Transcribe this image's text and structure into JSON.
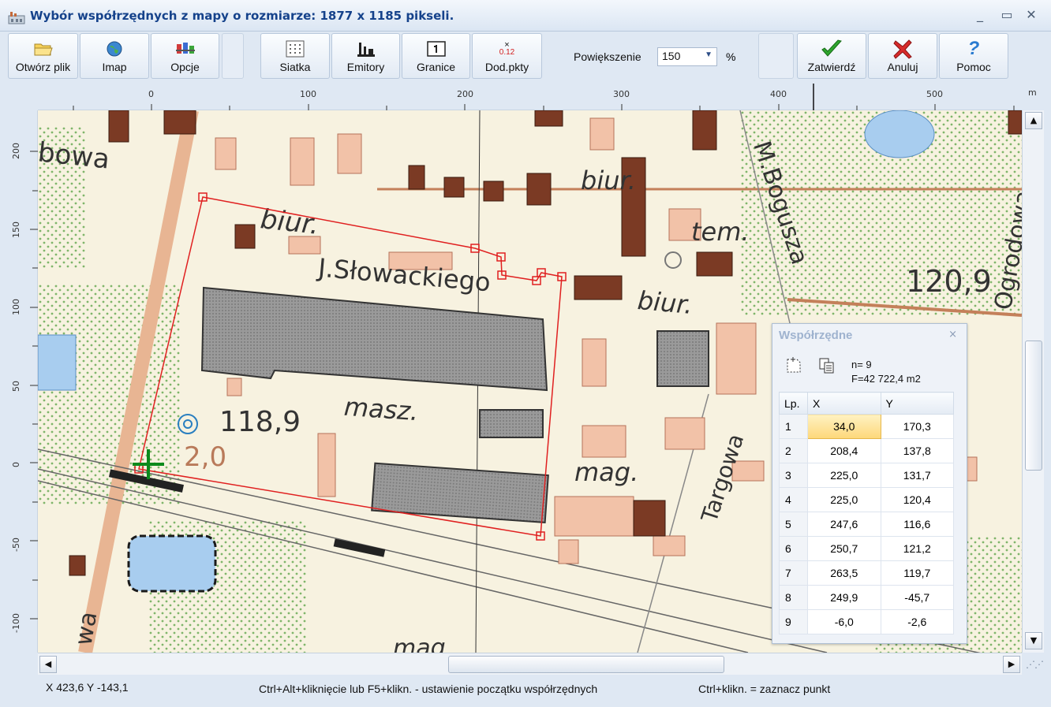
{
  "window": {
    "title": "Wybór współrzędnych z mapy o rozmiarze: 1877 x 1185 pikseli.",
    "minimize": "_",
    "maximize": "▭",
    "close": "✕"
  },
  "toolbar": {
    "open_file": "Otwórz plik",
    "imap": "Imap",
    "options": "Opcje",
    "grid": "Siatka",
    "emitters": "Emitory",
    "boundaries": "Granice",
    "add_points": "Dod.pkty",
    "add_points_icon_text": "0.12",
    "zoom_label": "Powiększenie",
    "zoom_value": "150",
    "zoom_unit": "%",
    "confirm": "Zatwierdź",
    "cancel": "Anuluj",
    "help": "Pomoc"
  },
  "ruler": {
    "x_ticks": [
      "0",
      "100",
      "200",
      "300",
      "400",
      "500"
    ],
    "x_unit": "m",
    "y_ticks": [
      "200",
      "150",
      "100",
      "50",
      "0",
      "-50",
      "-100"
    ]
  },
  "map_labels": {
    "bowa": "bowa",
    "biur1": "biur.",
    "biur2": "biur.",
    "biur3": "biur.",
    "slowackiego": "J.Słowackiego",
    "masz": "masz.",
    "height1": "118,9",
    "height2": "2,0",
    "mag": "mag.",
    "mag2": "mag",
    "boguszа": "M.Bogusza",
    "targowa": "Targowa",
    "ogrodowa": "Ogrodowa",
    "height3": "120,9",
    "tem": "tem.",
    "wa": "wa"
  },
  "coords_panel": {
    "title": "Współrzędne",
    "close": "×",
    "count": "n= 9",
    "area": "F=42 722,4 m2",
    "columns": [
      "Lp.",
      "X",
      "Y"
    ],
    "rows": [
      {
        "lp": "1",
        "x": "34,0",
        "y": "170,3"
      },
      {
        "lp": "2",
        "x": "208,4",
        "y": "137,8"
      },
      {
        "lp": "3",
        "x": "225,0",
        "y": "131,7"
      },
      {
        "lp": "4",
        "x": "225,0",
        "y": "120,4"
      },
      {
        "lp": "5",
        "x": "247,6",
        "y": "116,6"
      },
      {
        "lp": "6",
        "x": "250,7",
        "y": "121,2"
      },
      {
        "lp": "7",
        "x": "263,5",
        "y": "119,7"
      },
      {
        "lp": "8",
        "x": "249,9",
        "y": "-45,7"
      },
      {
        "lp": "9",
        "x": "-6,0",
        "y": "-2,6"
      }
    ]
  },
  "status": {
    "cursor": "X 423,6 Y -143,1",
    "hint1": "Ctrl+Alt+kliknięcie lub F5+klikn. - ustawienie początku współrzędnych",
    "hint2": "Ctrl+klikn. = zaznacz punkt"
  },
  "colors": {
    "accent": "#15428b",
    "polygon": "#e02020",
    "building_dark": "#7b3a24",
    "building_light": "#f2c2a8"
  }
}
